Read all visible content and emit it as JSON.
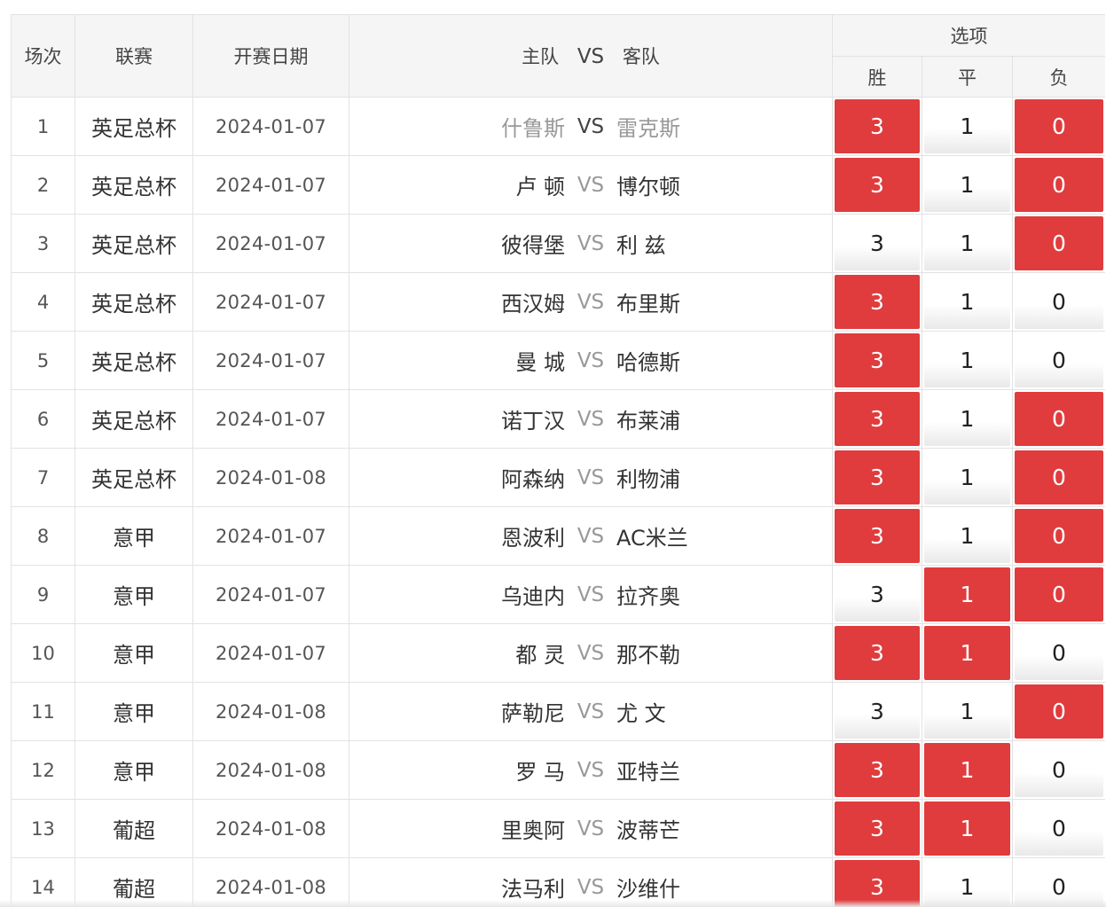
{
  "header": {
    "col_round": "场次",
    "col_league": "联赛",
    "col_date": "开赛日期",
    "col_home": "主队",
    "col_vs": "VS",
    "col_away": "客队",
    "col_options": "选项",
    "opt_win": "胜",
    "opt_draw": "平",
    "opt_lose": "负"
  },
  "accent_color": "#e03c3d",
  "rows": [
    {
      "num": "1",
      "league": "英足总杯",
      "date": "2024-01-07",
      "home": "什鲁斯",
      "vs": "VS",
      "away": "雷克斯",
      "win": "3",
      "draw": "1",
      "lose": "0",
      "win_on": true,
      "draw_on": false,
      "lose_on": true,
      "muted": true
    },
    {
      "num": "2",
      "league": "英足总杯",
      "date": "2024-01-07",
      "home": "卢 顿",
      "vs": "VS",
      "away": "博尔顿",
      "win": "3",
      "draw": "1",
      "lose": "0",
      "win_on": true,
      "draw_on": false,
      "lose_on": true
    },
    {
      "num": "3",
      "league": "英足总杯",
      "date": "2024-01-07",
      "home": "彼得堡",
      "vs": "VS",
      "away": "利 兹",
      "win": "3",
      "draw": "1",
      "lose": "0",
      "win_on": false,
      "draw_on": false,
      "lose_on": true
    },
    {
      "num": "4",
      "league": "英足总杯",
      "date": "2024-01-07",
      "home": "西汉姆",
      "vs": "VS",
      "away": "布里斯",
      "win": "3",
      "draw": "1",
      "lose": "0",
      "win_on": true,
      "draw_on": false,
      "lose_on": false
    },
    {
      "num": "5",
      "league": "英足总杯",
      "date": "2024-01-07",
      "home": "曼 城",
      "vs": "VS",
      "away": "哈德斯",
      "win": "3",
      "draw": "1",
      "lose": "0",
      "win_on": true,
      "draw_on": false,
      "lose_on": false
    },
    {
      "num": "6",
      "league": "英足总杯",
      "date": "2024-01-07",
      "home": "诺丁汉",
      "vs": "VS",
      "away": "布莱浦",
      "win": "3",
      "draw": "1",
      "lose": "0",
      "win_on": true,
      "draw_on": false,
      "lose_on": true
    },
    {
      "num": "7",
      "league": "英足总杯",
      "date": "2024-01-08",
      "home": "阿森纳",
      "vs": "VS",
      "away": "利物浦",
      "win": "3",
      "draw": "1",
      "lose": "0",
      "win_on": true,
      "draw_on": false,
      "lose_on": true
    },
    {
      "num": "8",
      "league": "意甲",
      "date": "2024-01-07",
      "home": "恩波利",
      "vs": "VS",
      "away": "AC米兰",
      "win": "3",
      "draw": "1",
      "lose": "0",
      "win_on": true,
      "draw_on": false,
      "lose_on": true
    },
    {
      "num": "9",
      "league": "意甲",
      "date": "2024-01-07",
      "home": "乌迪内",
      "vs": "VS",
      "away": "拉齐奥",
      "win": "3",
      "draw": "1",
      "lose": "0",
      "win_on": false,
      "draw_on": true,
      "lose_on": true
    },
    {
      "num": "10",
      "league": "意甲",
      "date": "2024-01-07",
      "home": "都 灵",
      "vs": "VS",
      "away": "那不勒",
      "win": "3",
      "draw": "1",
      "lose": "0",
      "win_on": true,
      "draw_on": true,
      "lose_on": false
    },
    {
      "num": "11",
      "league": "意甲",
      "date": "2024-01-08",
      "home": "萨勒尼",
      "vs": "VS",
      "away": "尤 文",
      "win": "3",
      "draw": "1",
      "lose": "0",
      "win_on": false,
      "draw_on": false,
      "lose_on": true
    },
    {
      "num": "12",
      "league": "意甲",
      "date": "2024-01-08",
      "home": "罗 马",
      "vs": "VS",
      "away": "亚特兰",
      "win": "3",
      "draw": "1",
      "lose": "0",
      "win_on": true,
      "draw_on": true,
      "lose_on": false
    },
    {
      "num": "13",
      "league": "葡超",
      "date": "2024-01-08",
      "home": "里奥阿",
      "vs": "VS",
      "away": "波蒂芒",
      "win": "3",
      "draw": "1",
      "lose": "0",
      "win_on": true,
      "draw_on": true,
      "lose_on": false
    },
    {
      "num": "14",
      "league": "葡超",
      "date": "2024-01-08",
      "home": "法马利",
      "vs": "VS",
      "away": "沙维什",
      "win": "3",
      "draw": "1",
      "lose": "0",
      "win_on": true,
      "draw_on": false,
      "lose_on": false
    }
  ]
}
